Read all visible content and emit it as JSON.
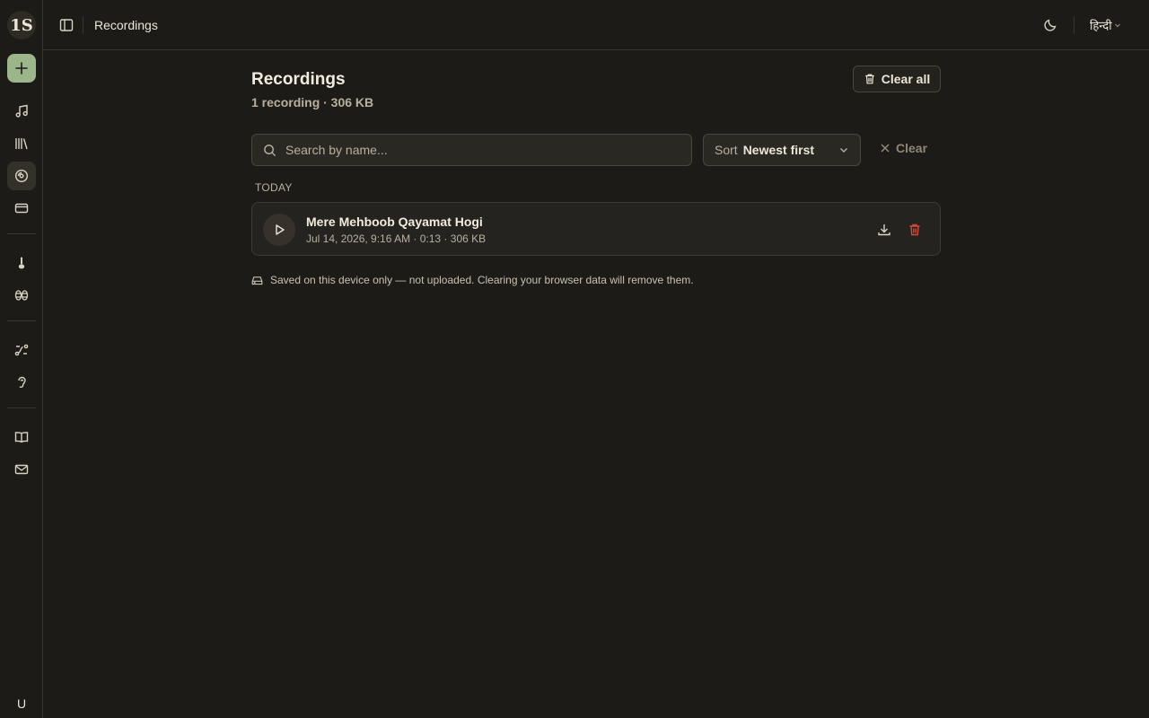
{
  "sidebar": {
    "logo_text": "1S",
    "new_icon": "plus-icon",
    "items": [
      {
        "name": "music-icon"
      },
      {
        "name": "library-icon"
      },
      {
        "name": "recordings-disc-icon",
        "active": true
      },
      {
        "name": "credit-card-icon"
      },
      {
        "name": "sitar-icon"
      },
      {
        "name": "tabla-icon"
      },
      {
        "name": "route-icon"
      },
      {
        "name": "ear-icon"
      },
      {
        "name": "book-open-icon"
      },
      {
        "name": "mail-icon"
      }
    ],
    "avatar_label": "U"
  },
  "topbar": {
    "breadcrumb": "Recordings",
    "language": "हिन्दी"
  },
  "main": {
    "title": "Recordings",
    "summary": "1 recording · 306 KB",
    "clear_all_label": "Clear all",
    "search_placeholder": "Search by name...",
    "sort_label": "Sort",
    "sort_value": "Newest first",
    "clear_label": "Clear",
    "groups": [
      {
        "label": "TODAY",
        "recordings": [
          {
            "title": "Mere Mehboob Qayamat Hogi",
            "meta": "Jul 14, 2026, 9:16 AM · 0:13 · 306 KB"
          }
        ]
      }
    ],
    "footnote": "Saved on this device only — not uploaded. Clearing your browser data will remove them."
  },
  "colors": {
    "background": "#1d1b17",
    "accent": "#9db58b",
    "danger": "#d24a3c"
  }
}
